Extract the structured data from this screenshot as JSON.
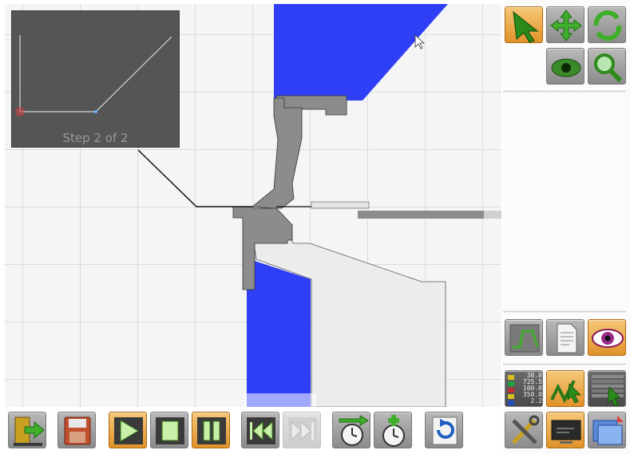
{
  "preview": {
    "step_label": "Step 2 of 2"
  },
  "status_readout": [
    "30.0",
    "725.5",
    "100.0",
    "350.0",
    "2.2"
  ],
  "colors": {
    "tool_blue": "#2f3ff5",
    "part_gray": "#8c8c8c",
    "frame_light": "#ececec",
    "button_active": "#e6a13c"
  },
  "icons": {
    "select": "arrow-cursor-icon",
    "move": "move-arrows-icon",
    "rotate": "rotate-icon",
    "view": "eye-icon",
    "zoom": "magnifier-icon",
    "graph": "graph-icon",
    "document": "document-icon",
    "visibility": "eye-visibility-icon",
    "readout": "numeric-readout-icon",
    "bend": "bend-cursor-icon",
    "table": "table-cursor-icon",
    "tools": "tools-icon",
    "screen": "screen-icon",
    "window": "window-icon",
    "exit": "exit-icon",
    "save": "save-icon",
    "play": "play-icon",
    "stop": "stop-icon",
    "pause": "pause-icon",
    "rewind": "rewind-icon",
    "forward": "forward-icon",
    "timer_next": "timer-arrow-icon",
    "timer_add": "timer-add-icon",
    "undo": "undo-icon"
  }
}
